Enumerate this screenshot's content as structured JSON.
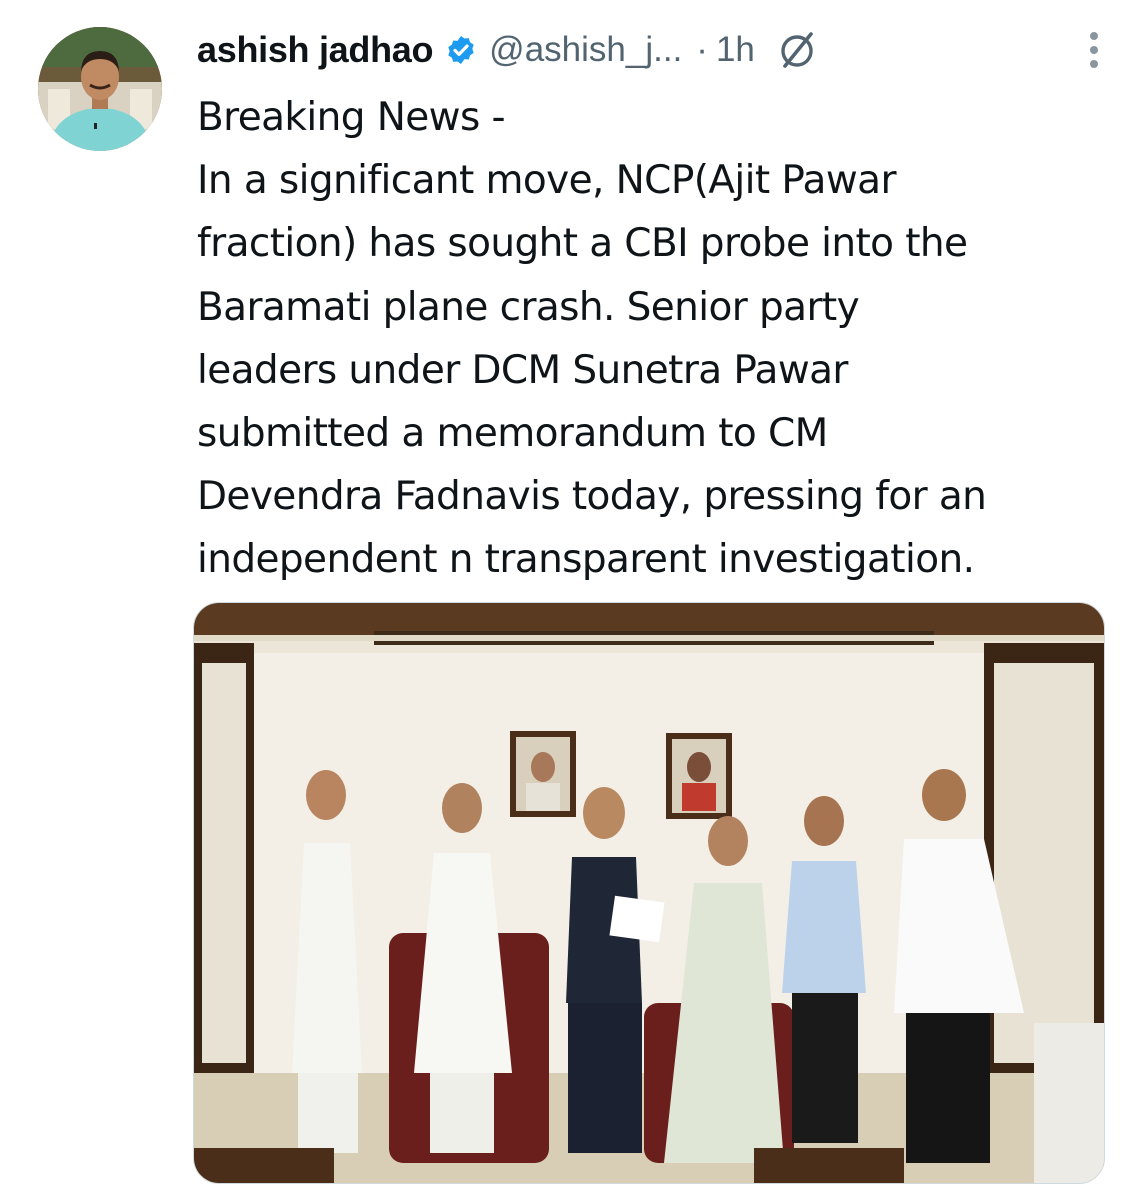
{
  "tweet": {
    "author": {
      "display_name": "ashish jadhao",
      "handle": "@ashish_j...",
      "verified": true,
      "avatar_icon": "profile-photo-avatar"
    },
    "separator": "·",
    "timestamp": "1h",
    "icons": {
      "verified": "verified-badge-icon",
      "grok": "grok-icon",
      "more": "more-options-icon"
    },
    "text": "Breaking News -\nIn a significant move, NCP(Ajit Pawar\nfraction) has sought a CBI probe into the\nBaramati plane crash. Senior party\nleaders under DCM Sunetra Pawar\nsubmitted a memorandum to CM\nDevendra Fadnavis today, pressing for an\nindependent n transparent investigation.",
    "media": {
      "type": "photo"
    }
  },
  "colors": {
    "text_primary": "#0f1419",
    "text_secondary": "#536471",
    "verified_blue": "#1d9bf0",
    "media_border": "#cfd9de"
  }
}
